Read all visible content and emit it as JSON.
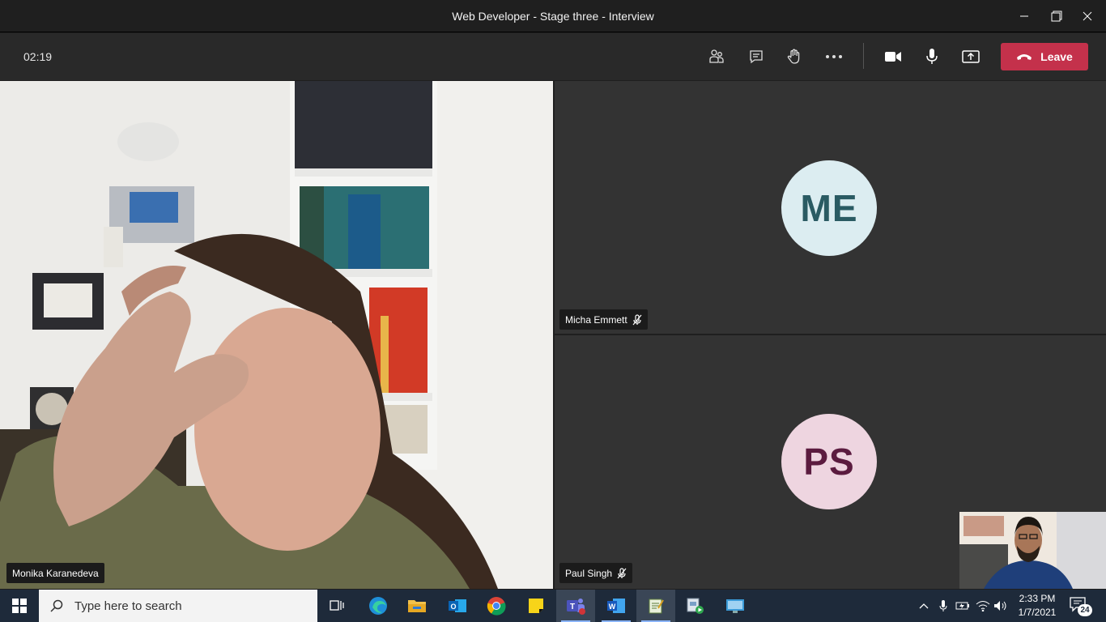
{
  "window": {
    "title": "Web Developer - Stage three - Interview"
  },
  "toolbar": {
    "timer": "02:19",
    "leave_label": "Leave"
  },
  "participants": [
    {
      "name": "Monika Karanedeva",
      "video": true
    },
    {
      "name": "Micha Emmett",
      "initials": "ME",
      "muted": true,
      "avatar_color": "#dcedf1"
    },
    {
      "name": "Paul Singh",
      "initials": "PS",
      "muted": true,
      "avatar_color": "#eed5e0"
    }
  ],
  "taskbar": {
    "search_placeholder": "Type here to search",
    "time": "2:33 PM",
    "date": "1/7/2021",
    "notification_count": "24",
    "apps": [
      "task-view-icon",
      "edge-icon",
      "file-explorer-icon",
      "outlook-icon",
      "chrome-icon",
      "sticky-notes-icon",
      "teams-icon",
      "word-icon",
      "notepad-icon",
      "media-app-icon",
      "remote-desktop-icon"
    ]
  },
  "colors": {
    "leave": "#c4314b",
    "tile_bg": "#333333",
    "taskbar": "#1e2a3a"
  }
}
